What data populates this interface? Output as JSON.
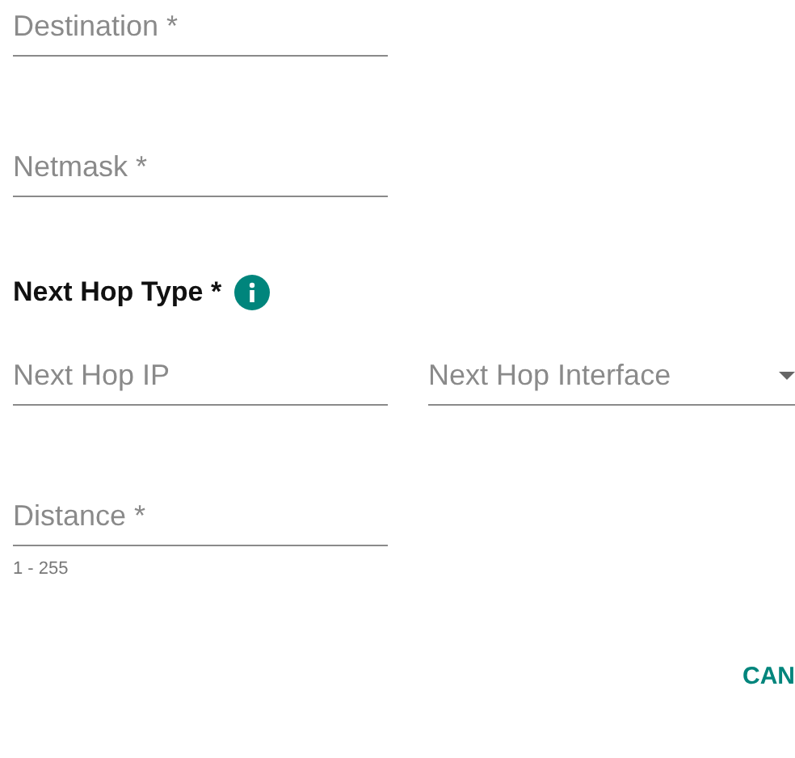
{
  "fields": [
    {
      "placeholder": "Destination *"
    },
    {
      "placeholder": "Netmask *"
    }
  ],
  "next_hop_type": {
    "label": "Next Hop Type *"
  },
  "next_hop": {
    "ip": {
      "placeholder": "Next Hop IP"
    },
    "interface": {
      "placeholder": "Next Hop Interface"
    }
  },
  "distance": {
    "placeholder": "Distance *",
    "hint": "1 - 255"
  },
  "buttons": [
    "CAN"
  ]
}
